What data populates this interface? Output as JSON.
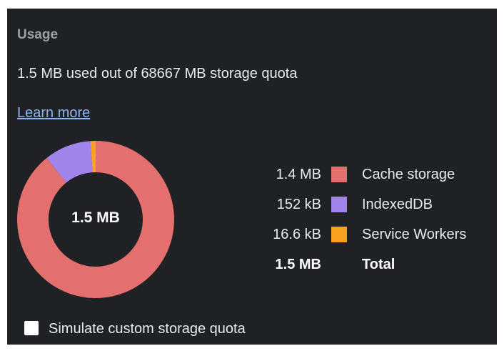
{
  "usage": {
    "title": "Usage",
    "summary": "1.5 MB used out of 68667 MB storage quota",
    "learn_more": "Learn more",
    "total_center": "1.5 MB"
  },
  "chart_data": {
    "type": "pie",
    "categories": [
      "Cache storage",
      "IndexedDB",
      "Service Workers"
    ],
    "values": [
      1.4,
      0.152,
      0.0166
    ],
    "value_labels": [
      "1.4 MB",
      "152 kB",
      "16.6 kB"
    ],
    "units": "MB",
    "colors": [
      "#e46f6f",
      "#a185ea",
      "#f7a31f"
    ],
    "total": {
      "value_label": "1.5 MB",
      "label": "Total"
    }
  },
  "quota_option": {
    "label": "Simulate custom storage quota",
    "checked": false
  }
}
